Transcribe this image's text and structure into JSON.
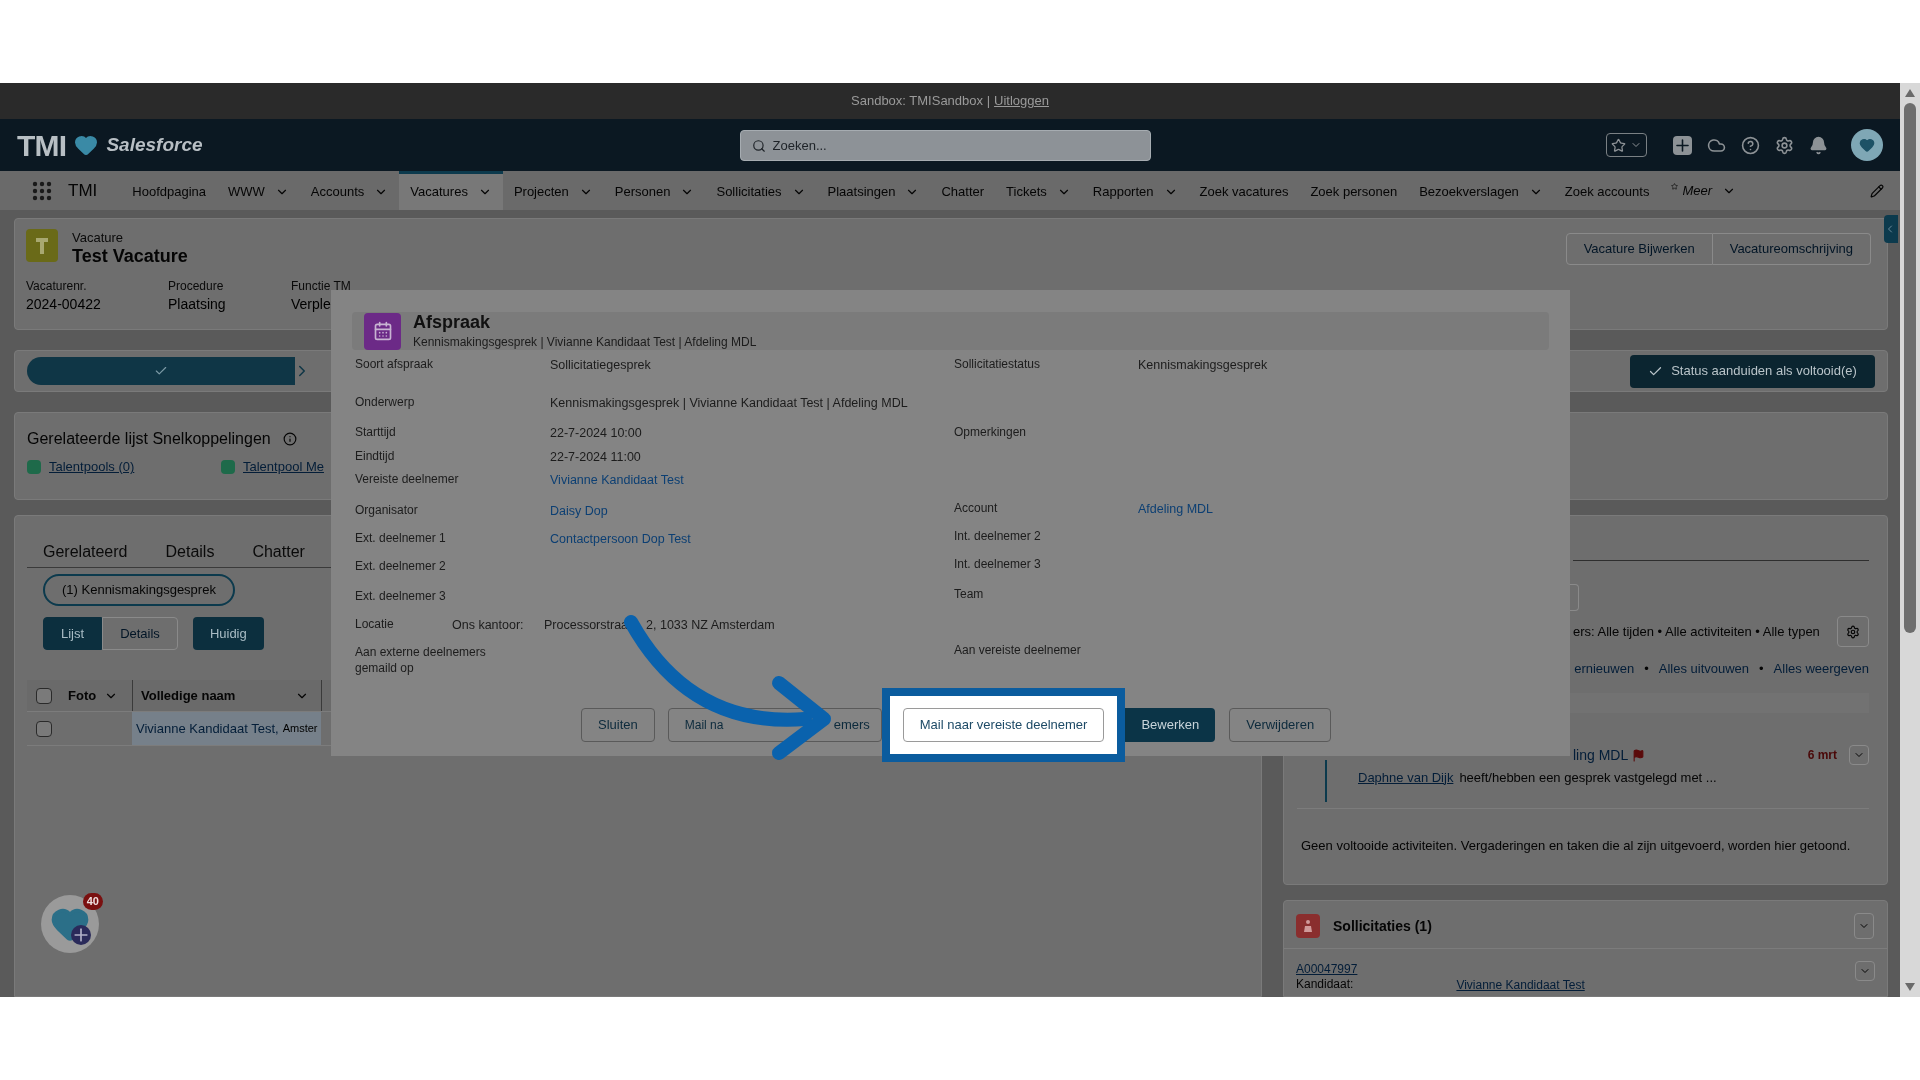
{
  "system_bar": {
    "text": "Sandbox: TMISandbox |",
    "link": "Uitloggen"
  },
  "header": {
    "logo": "TMI",
    "brand": "Salesforce",
    "search": {
      "placeholder": "Zoeken..."
    }
  },
  "nav": {
    "app_label": "TMI",
    "items": [
      {
        "label": "Hoofdpagina",
        "dropdown": false,
        "selected": false
      },
      {
        "label": "WWW",
        "dropdown": true,
        "selected": false
      },
      {
        "label": "Accounts",
        "dropdown": true,
        "selected": false
      },
      {
        "label": "Vacatures",
        "dropdown": true,
        "selected": true
      },
      {
        "label": "Projecten",
        "dropdown": true,
        "selected": false
      },
      {
        "label": "Personen",
        "dropdown": true,
        "selected": false
      },
      {
        "label": "Sollicitaties",
        "dropdown": true,
        "selected": false
      },
      {
        "label": "Plaatsingen",
        "dropdown": true,
        "selected": false
      },
      {
        "label": "Chatter",
        "dropdown": false,
        "selected": false
      },
      {
        "label": "Tickets",
        "dropdown": true,
        "selected": false
      },
      {
        "label": "Rapporten",
        "dropdown": true,
        "selected": false
      },
      {
        "label": "Zoek vacatures",
        "dropdown": false,
        "selected": false
      },
      {
        "label": "Zoek personen",
        "dropdown": false,
        "selected": false
      },
      {
        "label": "Bezoekverslagen",
        "dropdown": true,
        "selected": false
      },
      {
        "label": "Zoek accounts",
        "dropdown": false,
        "selected": false
      }
    ],
    "more": "Meer"
  },
  "record": {
    "object": "Vacature",
    "title": "Test Vacature",
    "buttons": [
      "Vacature Bijwerken",
      "Vacatureomschrijving"
    ],
    "fields": [
      {
        "label": "Vacaturenr.",
        "value": "2024-00422"
      },
      {
        "label": "Procedure",
        "value": "Plaatsing"
      },
      {
        "label": "Functie TM",
        "value": "Verple"
      }
    ]
  },
  "path": {
    "status_button": "Status aanduiden als voltooid(e)"
  },
  "quick_links": {
    "title": "Gerelateerde lijst Snelkoppelingen",
    "links": [
      "Talentpools (0)",
      "Talentpool Me"
    ]
  },
  "tabs": [
    {
      "label": "Gerelateerd",
      "selected": false
    },
    {
      "label": "Details",
      "selected": false
    },
    {
      "label": "Chatter",
      "selected": false
    }
  ],
  "related": {
    "pill": "(1) Kennismakingsgesprek",
    "view_toggle": [
      {
        "label": "Lijst",
        "selected": true
      },
      {
        "label": "Details",
        "selected": false
      }
    ],
    "current_button": "Huidig",
    "table": {
      "select_all": {
        "checked": false
      },
      "columns": [
        "Foto",
        "Volledige naam"
      ],
      "rows": [
        {
          "checked": false,
          "name": "Vivianne Kandidaat Test,",
          "place": "Amster"
        }
      ]
    }
  },
  "activity": {
    "filter": "ers: Alle tijden • Alle activiteiten • Alle typen",
    "actions": [
      {
        "text": "ernieuwen",
        "kind": "link"
      },
      {
        "text": "•",
        "kind": "separator"
      },
      {
        "text": "Alles uitvouwen",
        "kind": "link"
      },
      {
        "text": "•",
        "kind": "separator"
      },
      {
        "text": "Alles weergeven",
        "kind": "link"
      }
    ],
    "item": {
      "subject": "ling MDL",
      "date": "6 mrt",
      "person": "Daphne van Dijk",
      "text": "heeft/hebben een gesprek vastgelegd met ..."
    },
    "empty": "Geen voltooide activiteiten. Vergaderingen en taken die al zijn uitgevoerd, worden hier getoond."
  },
  "applications": {
    "title": "Sollicitaties (1)",
    "record": "A00047997",
    "label": "Kandidaat:",
    "value": "Vivianne Kandidaat Test"
  },
  "badge": {
    "count": "40"
  },
  "modal": {
    "title": "Afspraak",
    "subtitle": "Kennismakingsgesprek | Vivianne Kandidaat Test | Afdeling MDL",
    "rows": [
      {
        "fields": [
          {
            "label": "Soort afspraak",
            "value": "Sollicitatiegesprek",
            "kind": "text"
          },
          {
            "label": "Sollicitatiestatus",
            "value": "Kennismakingsgesprek",
            "kind": "text"
          }
        ]
      },
      {
        "fields": [
          {
            "label": "Onderwerp",
            "value": "Kennismakingsgesprek | Vivianne Kandidaat Test | Afdeling MDL",
            "kind": "text"
          }
        ]
      },
      {
        "fields": [
          {
            "label": "Starttijd",
            "value": "22-7-2024 10:00",
            "kind": "text"
          },
          {
            "label": "Opmerkingen"
          }
        ]
      },
      {
        "fields": [
          {
            "label": "Eindtijd",
            "value": "22-7-2024 11:00",
            "kind": "text"
          }
        ]
      },
      {
        "fields": [
          {
            "label": "Vereiste deelnemer",
            "value": "Vivianne Kandidaat Test",
            "kind": "link"
          }
        ]
      },
      {
        "fields": [
          {
            "label": "Organisator",
            "value": "Daisy Dop",
            "kind": "link"
          },
          {
            "label": "Account",
            "value": "Afdeling MDL",
            "kind": "link"
          }
        ]
      },
      {
        "fields": [
          {
            "label": "Ext. deelnemer 1",
            "value": "Contactpersoon Dop Test",
            "kind": "link"
          },
          {
            "label": "Int. deelnemer 2"
          }
        ]
      },
      {
        "fields": [
          {
            "label": "Ext. deelnemer 2"
          },
          {
            "label": "Int. deelnemer 3"
          }
        ]
      },
      {
        "fields": [
          {
            "label": "Ext. deelnemer 3"
          },
          {
            "label": "Team"
          }
        ]
      },
      {
        "fields": [
          {
            "label": "Locatie",
            "sublabel": "Ons kantoor:",
            "value_parts": [
              "Processorstraa",
              "2, 1033 NZ Amsterdam"
            ],
            "kind": "text"
          }
        ]
      },
      {
        "fields": [
          {
            "label": "Aan externe deelnemers gemaild op"
          },
          {
            "label": "Aan vereiste deelnemer"
          }
        ]
      }
    ],
    "buttons": [
      {
        "label": "Sluiten",
        "kind": "outline"
      },
      {
        "label_parts": [
          "Mail na",
          "emers"
        ],
        "kind": "outline"
      },
      {
        "label": "Mail naar vereiste deelnemer",
        "kind": "highlighted"
      },
      {
        "label": "Bewerken",
        "kind": "primary"
      },
      {
        "label": "Verwijderen",
        "kind": "outline"
      }
    ]
  }
}
